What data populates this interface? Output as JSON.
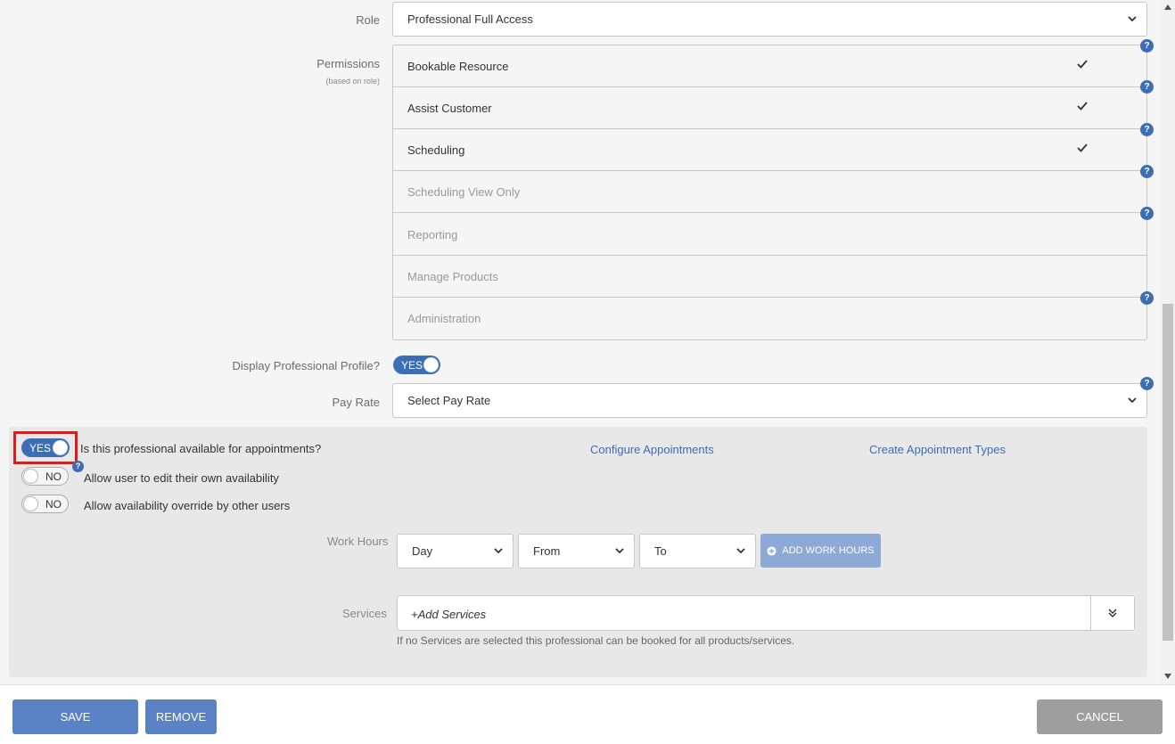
{
  "role": {
    "label": "Role",
    "value": "Professional Full Access"
  },
  "permissions": {
    "label": "Permissions",
    "sublabel": "(based on role)",
    "items": [
      {
        "label": "Bookable Resource",
        "checked": true
      },
      {
        "label": "Assist Customer",
        "checked": true
      },
      {
        "label": "Scheduling",
        "checked": true
      },
      {
        "label": "Scheduling View Only",
        "checked": false
      },
      {
        "label": "Reporting",
        "checked": false
      },
      {
        "label": "Manage Products",
        "checked": false
      },
      {
        "label": "Administration",
        "checked": false
      }
    ]
  },
  "help_glyph": "?",
  "display_profile": {
    "label": "Display Professional Profile?",
    "toggle": "YES"
  },
  "pay_rate": {
    "label": "Pay Rate",
    "value": "Select Pay Rate"
  },
  "appointments": {
    "available_toggle": "YES",
    "available_label": "Is this professional available for appointments?",
    "configure_link": "Configure Appointments",
    "create_types_link": "Create Appointment Types",
    "edit_own_toggle": "NO",
    "edit_own_label": "Allow user to edit their own availability",
    "override_toggle": "NO",
    "override_label": "Allow availability override by other users",
    "work_hours": {
      "label": "Work Hours",
      "day": "Day",
      "from": "From",
      "to": "To",
      "add_button": "ADD WORK HOURS"
    },
    "services": {
      "label": "Services",
      "placeholder": "+Add Services",
      "note": "If no Services are selected this professional can be booked for all products/services."
    }
  },
  "footer": {
    "save": "SAVE",
    "remove": "REMOVE",
    "cancel": "CANCEL"
  },
  "colors": {
    "accent": "#3a6fb5",
    "button_blue": "#5a82c4",
    "cancel_grey": "#9e9e9e",
    "highlight": "#e01919"
  }
}
